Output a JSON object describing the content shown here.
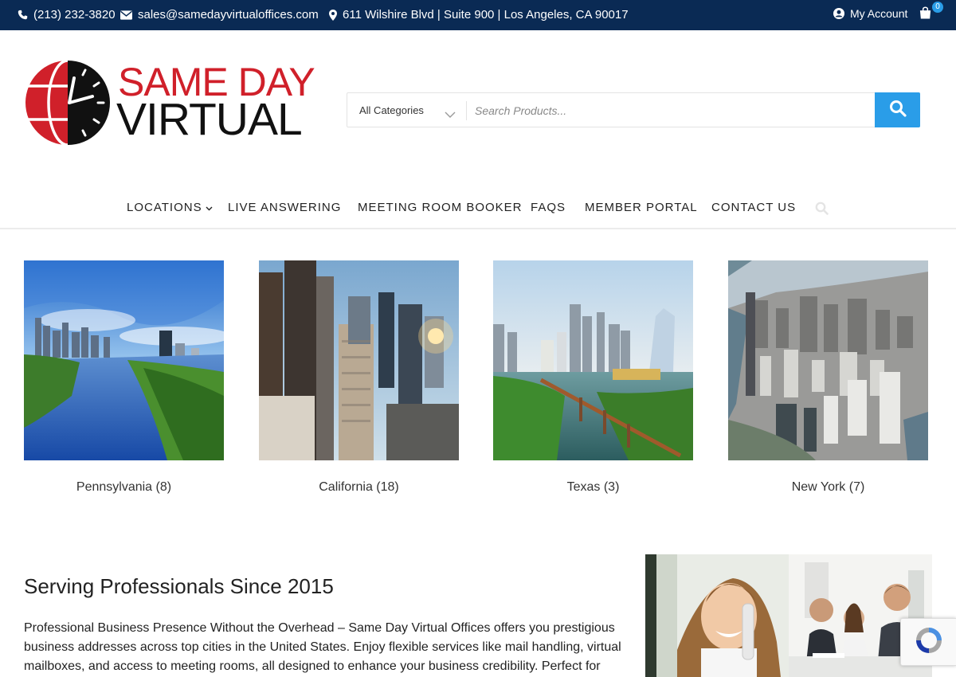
{
  "topbar": {
    "phone": "(213) 232-3820",
    "email": "sales@samedayvirtualoffices.com",
    "address": "611 Wilshire Blvd | Suite 900 | Los Angeles, CA 90017",
    "account_label": "My Account",
    "cart_count": "0",
    "icons": [
      "phone-icon",
      "envelope-icon",
      "map-pin-icon",
      "user-icon",
      "shopping-bag-icon"
    ]
  },
  "logo": {
    "line1": "SAME DAY",
    "line2": "VIRTUAL",
    "colors": {
      "red": "#d0202a",
      "black": "#111111"
    }
  },
  "search": {
    "category": "All Categories",
    "placeholder": "Search Products...",
    "button_color": "#2a9de8"
  },
  "nav": {
    "items": [
      "LOCATIONS",
      "LIVE ANSWERING",
      "MEETING ROOM BOOKER",
      "FAQS",
      "MEMBER PORTAL",
      "CONTACT US"
    ]
  },
  "locations": [
    {
      "label": "Pennsylvania (8)"
    },
    {
      "label": "California (18)"
    },
    {
      "label": "Texas (3)"
    },
    {
      "label": "New York (7)"
    }
  ],
  "about": {
    "title": "Serving Professionals Since 2015",
    "text": "Professional Business Presence Without the Overhead – Same Day Virtual Offices offers you prestigious business addresses across top cities in the United States. Enjoy flexible services like mail handling, virtual mailboxes, and access to meeting rooms, all designed to enhance your business credibility. Perfect for"
  },
  "colors": {
    "topbar_bg": "#0a2a54",
    "accent": "#2a9de8"
  }
}
